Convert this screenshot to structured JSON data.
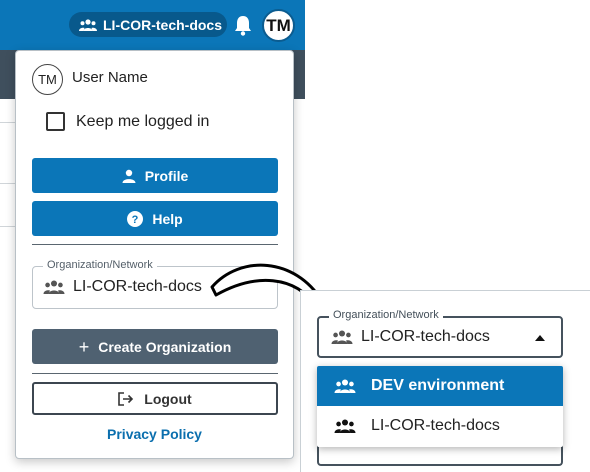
{
  "header": {
    "org_chip_label": "LI-COR-tech-docs",
    "avatar_initials": "TM"
  },
  "user_menu": {
    "avatar_initials": "TM",
    "user_name": "User Name",
    "keep_logged_in_label": "Keep me logged in",
    "keep_logged_in_checked": false,
    "profile_label": "Profile",
    "help_label": "Help",
    "org_field": {
      "legend": "Organization/Network",
      "value": "LI-COR-tech-docs"
    },
    "create_org_label": "Create Organization",
    "logout_label": "Logout",
    "privacy_label": "Privacy Policy"
  },
  "zoomed_select": {
    "legend": "Organization/Network",
    "value": "LI-COR-tech-docs",
    "options": [
      {
        "label": "DEV environment",
        "selected": true
      },
      {
        "label": "LI-COR-tech-docs",
        "selected": false
      }
    ]
  },
  "colors": {
    "primary": "#0b76b8",
    "secondary": "#4f6171",
    "dark_header": "#3f4f5d"
  }
}
